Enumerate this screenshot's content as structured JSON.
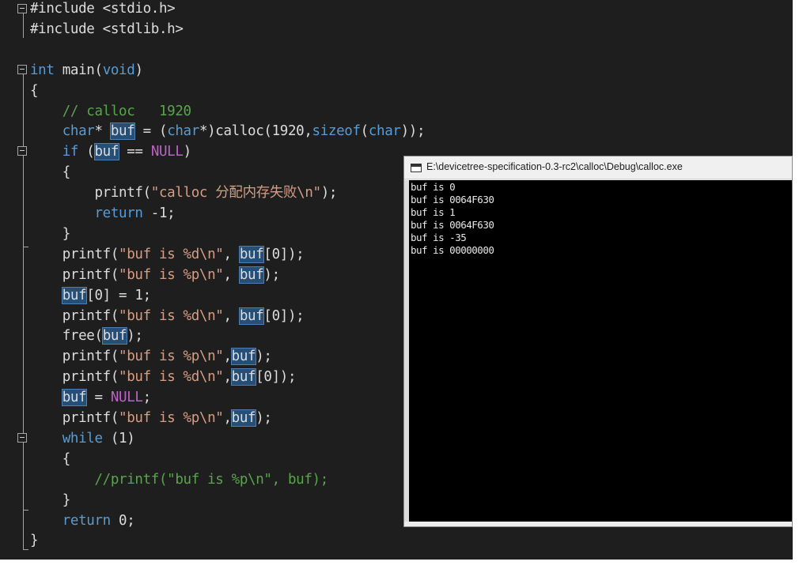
{
  "editor": {
    "lines": [
      [
        {
          "t": "#include <stdio.h>",
          "c": "plain"
        }
      ],
      [
        {
          "t": "#include <stdlib.h>",
          "c": "plain"
        }
      ],
      [],
      [
        {
          "t": "int",
          "c": "kw"
        },
        {
          "t": " main(",
          "c": "plain"
        },
        {
          "t": "void",
          "c": "kw"
        },
        {
          "t": ")",
          "c": "plain"
        }
      ],
      [
        {
          "t": "{",
          "c": "plain"
        }
      ],
      [
        {
          "t": "    ",
          "c": "plain"
        },
        {
          "t": "// calloc   1920",
          "c": "cmt"
        }
      ],
      [
        {
          "t": "    ",
          "c": "plain"
        },
        {
          "t": "char",
          "c": "kw"
        },
        {
          "t": "* ",
          "c": "plain"
        },
        {
          "t": "buf",
          "c": "hl"
        },
        {
          "t": " = (",
          "c": "plain"
        },
        {
          "t": "char",
          "c": "kw"
        },
        {
          "t": "*)calloc(1920,",
          "c": "plain"
        },
        {
          "t": "sizeof",
          "c": "kw"
        },
        {
          "t": "(",
          "c": "plain"
        },
        {
          "t": "char",
          "c": "kw"
        },
        {
          "t": "));",
          "c": "plain"
        }
      ],
      [
        {
          "t": "    ",
          "c": "plain"
        },
        {
          "t": "if",
          "c": "kw"
        },
        {
          "t": " (",
          "c": "plain"
        },
        {
          "t": "buf",
          "c": "hl"
        },
        {
          "t": " == ",
          "c": "plain"
        },
        {
          "t": "NULL",
          "c": "mac"
        },
        {
          "t": ")",
          "c": "plain"
        }
      ],
      [
        {
          "t": "    {",
          "c": "plain"
        }
      ],
      [
        {
          "t": "        printf(",
          "c": "plain"
        },
        {
          "t": "\"calloc 分配内存失败\\n\"",
          "c": "str"
        },
        {
          "t": ");",
          "c": "plain"
        }
      ],
      [
        {
          "t": "        ",
          "c": "plain"
        },
        {
          "t": "return",
          "c": "kw"
        },
        {
          "t": " -1;",
          "c": "plain"
        }
      ],
      [
        {
          "t": "    }",
          "c": "plain"
        }
      ],
      [
        {
          "t": "    printf(",
          "c": "plain"
        },
        {
          "t": "\"buf is %d\\n\"",
          "c": "str"
        },
        {
          "t": ", ",
          "c": "plain"
        },
        {
          "t": "buf",
          "c": "hl"
        },
        {
          "t": "[0]);",
          "c": "plain"
        }
      ],
      [
        {
          "t": "    printf(",
          "c": "plain"
        },
        {
          "t": "\"buf is %p\\n\"",
          "c": "str"
        },
        {
          "t": ", ",
          "c": "plain"
        },
        {
          "t": "buf",
          "c": "hl"
        },
        {
          "t": ");",
          "c": "plain"
        }
      ],
      [
        {
          "t": "    ",
          "c": "plain"
        },
        {
          "t": "buf",
          "c": "hl"
        },
        {
          "t": "[0] = 1;",
          "c": "plain"
        }
      ],
      [
        {
          "t": "    printf(",
          "c": "plain"
        },
        {
          "t": "\"buf is %d\\n\"",
          "c": "str"
        },
        {
          "t": ", ",
          "c": "plain"
        },
        {
          "t": "buf",
          "c": "hl"
        },
        {
          "t": "[0]);",
          "c": "plain"
        }
      ],
      [
        {
          "t": "    free(",
          "c": "plain"
        },
        {
          "t": "buf",
          "c": "hl"
        },
        {
          "t": ");",
          "c": "plain"
        }
      ],
      [
        {
          "t": "    printf(",
          "c": "plain"
        },
        {
          "t": "\"buf is %p\\n\"",
          "c": "str"
        },
        {
          "t": ",",
          "c": "plain"
        },
        {
          "t": "buf",
          "c": "hl"
        },
        {
          "t": ");",
          "c": "plain"
        }
      ],
      [
        {
          "t": "    printf(",
          "c": "plain"
        },
        {
          "t": "\"buf is %d\\n\"",
          "c": "str"
        },
        {
          "t": ",",
          "c": "plain"
        },
        {
          "t": "buf",
          "c": "hl"
        },
        {
          "t": "[0]);",
          "c": "plain"
        }
      ],
      [
        {
          "t": "    ",
          "c": "plain"
        },
        {
          "t": "buf",
          "c": "hl"
        },
        {
          "t": " = ",
          "c": "plain"
        },
        {
          "t": "NULL",
          "c": "mac"
        },
        {
          "t": ";",
          "c": "plain"
        }
      ],
      [
        {
          "t": "    printf(",
          "c": "plain"
        },
        {
          "t": "\"buf is %p\\n\"",
          "c": "str"
        },
        {
          "t": ",",
          "c": "plain"
        },
        {
          "t": "buf",
          "c": "hl"
        },
        {
          "t": ");",
          "c": "plain"
        }
      ],
      [
        {
          "t": "    ",
          "c": "plain"
        },
        {
          "t": "while",
          "c": "kw"
        },
        {
          "t": " (1)",
          "c": "plain"
        }
      ],
      [
        {
          "t": "    {",
          "c": "plain"
        }
      ],
      [
        {
          "t": "        ",
          "c": "plain"
        },
        {
          "t": "//printf(\"buf is %p\\n\", buf);",
          "c": "cmt"
        }
      ],
      [
        {
          "t": "    }",
          "c": "plain"
        }
      ],
      [
        {
          "t": "    ",
          "c": "plain"
        },
        {
          "t": "return",
          "c": "kw"
        },
        {
          "t": " 0;",
          "c": "plain"
        }
      ],
      [
        {
          "t": "}",
          "c": "plain"
        }
      ]
    ]
  },
  "console": {
    "title": "E:\\devicetree-specification-0.3-rc2\\calloc\\Debug\\calloc.exe",
    "output": [
      "buf is 0",
      "buf is 0064F630",
      "buf is 1",
      "buf is 0064F630",
      "buf is -35",
      "buf is 00000000"
    ]
  },
  "colors": {
    "editor_bg": "#1e1e1e",
    "keyword": "#569cd6",
    "string": "#d69d85",
    "comment": "#57a64a",
    "macro": "#bd63c5",
    "highlight": "#264f78",
    "console_bg": "#000000"
  }
}
